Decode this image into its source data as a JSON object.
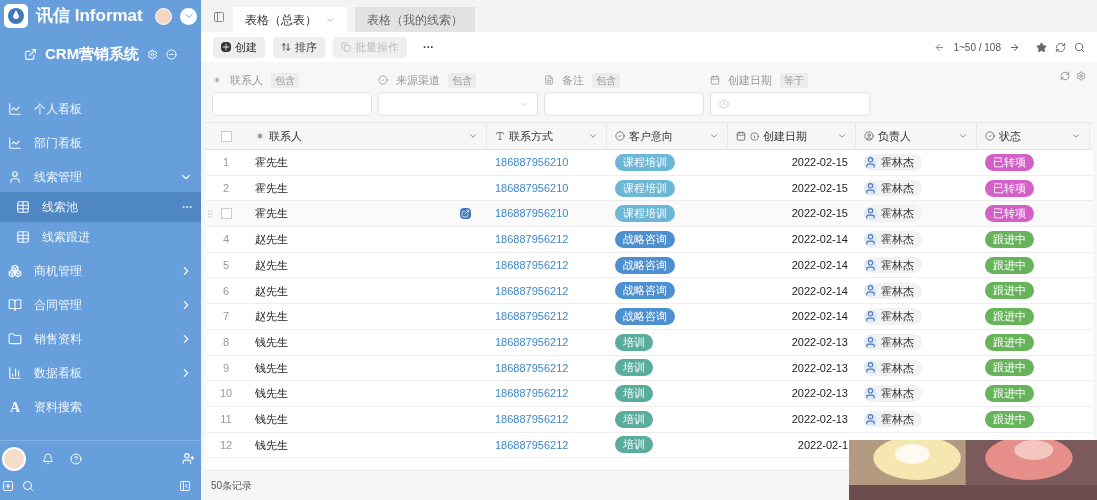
{
  "sidebar": {
    "brand": "讯信 Informat",
    "app_title": "CRM营销系统",
    "items": [
      {
        "label": "个人看板",
        "selected": false
      },
      {
        "label": "部门看板",
        "selected": false
      },
      {
        "label": "线索管理",
        "selected": false,
        "expanded": true,
        "children": [
          {
            "label": "线索池",
            "selected": true
          },
          {
            "label": "线索跟进",
            "selected": false
          }
        ]
      },
      {
        "label": "商机管理",
        "selected": false,
        "expanded": false
      },
      {
        "label": "合同管理",
        "selected": false,
        "expanded": false
      },
      {
        "label": "销售资料",
        "selected": false,
        "expanded": false
      },
      {
        "label": "数据看板",
        "selected": false,
        "expanded": false
      },
      {
        "label": "资料搜索",
        "selected": false,
        "glyph": "A"
      }
    ]
  },
  "tabs": [
    {
      "label": "表格（总表）",
      "selected": true
    },
    {
      "label": "表格（我的线索）",
      "selected": false
    }
  ],
  "toolbar": {
    "buttons": [
      {
        "label": "创建",
        "disabled": false
      },
      {
        "label": "排序",
        "disabled": false
      },
      {
        "label": "批量操作",
        "disabled": true
      }
    ],
    "more": "···",
    "pager": "1~50 / 108"
  },
  "filters": [
    {
      "label": "联系人",
      "kind": "text",
      "operator": "包含"
    },
    {
      "label": "来源渠道",
      "kind": "select",
      "operator": "包含"
    },
    {
      "label": "备注",
      "kind": "text",
      "operator": "包含"
    },
    {
      "label": "创建日期",
      "kind": "date",
      "operator": "等于"
    }
  ],
  "table": {
    "select_all": {
      "checked": false
    },
    "columns": [
      "联系人",
      "联系方式",
      "客户意向",
      "创建日期",
      "负责人",
      "状态"
    ],
    "rows": [
      {
        "index": "1",
        "hovered": false,
        "name": "霍先生",
        "phone": "186887956210",
        "intent": {
          "label": "课程培训",
          "color": "#6cb6d6"
        },
        "date": "2022-02-15",
        "owner": "霍林杰",
        "status": {
          "label": "已转项",
          "color": "#d260c6"
        }
      },
      {
        "index": "2",
        "hovered": false,
        "name": "霍先生",
        "phone": "186887956210",
        "intent": {
          "label": "课程培训",
          "color": "#6cb6d6"
        },
        "date": "2022-02-15",
        "owner": "霍林杰",
        "status": {
          "label": "已转项",
          "color": "#d260c6"
        }
      },
      {
        "hovered": true,
        "checked": false,
        "name": "霍先生",
        "phone": "186887956210",
        "intent": {
          "label": "课程培训",
          "color": "#6cb6d6"
        },
        "date": "2022-02-15",
        "owner": "霍林杰",
        "status": {
          "label": "已转项",
          "color": "#d260c6"
        }
      },
      {
        "index": "4",
        "hovered": false,
        "name": "赵先生",
        "phone": "186887956212",
        "intent": {
          "label": "战略咨询",
          "color": "#4e8fcf"
        },
        "date": "2022-02-14",
        "owner": "霍林杰",
        "status": {
          "label": "跟进中",
          "color": "#66b35a"
        }
      },
      {
        "index": "5",
        "hovered": false,
        "name": "赵先生",
        "phone": "186887956212",
        "intent": {
          "label": "战略咨询",
          "color": "#4e8fcf"
        },
        "date": "2022-02-14",
        "owner": "霍林杰",
        "status": {
          "label": "跟进中",
          "color": "#66b35a"
        }
      },
      {
        "index": "6",
        "hovered": false,
        "name": "赵先生",
        "phone": "186887956212",
        "intent": {
          "label": "战略咨询",
          "color": "#4e8fcf"
        },
        "date": "2022-02-14",
        "owner": "霍林杰",
        "status": {
          "label": "跟进中",
          "color": "#66b35a"
        }
      },
      {
        "index": "7",
        "hovered": false,
        "name": "赵先生",
        "phone": "186887956212",
        "intent": {
          "label": "战略咨询",
          "color": "#4e8fcf"
        },
        "date": "2022-02-14",
        "owner": "霍林杰",
        "status": {
          "label": "跟进中",
          "color": "#66b35a"
        }
      },
      {
        "index": "8",
        "hovered": false,
        "name": "钱先生",
        "phone": "186887956212",
        "intent": {
          "label": "培训",
          "color": "#5aad9d"
        },
        "date": "2022-02-13",
        "owner": "霍林杰",
        "status": {
          "label": "跟进中",
          "color": "#66b35a"
        }
      },
      {
        "index": "9",
        "hovered": false,
        "name": "钱先生",
        "phone": "186887956212",
        "intent": {
          "label": "培训",
          "color": "#5aad9d"
        },
        "date": "2022-02-13",
        "owner": "霍林杰",
        "status": {
          "label": "跟进中",
          "color": "#66b35a"
        }
      },
      {
        "index": "10",
        "hovered": false,
        "name": "钱先生",
        "phone": "186887956212",
        "intent": {
          "label": "培训",
          "color": "#5aad9d"
        },
        "date": "2022-02-13",
        "owner": "霍林杰",
        "status": {
          "label": "跟进中",
          "color": "#66b35a"
        }
      },
      {
        "index": "11",
        "hovered": false,
        "name": "钱先生",
        "phone": "186887956212",
        "intent": {
          "label": "培训",
          "color": "#5aad9d"
        },
        "date": "2022-02-13",
        "owner": "霍林杰",
        "status": {
          "label": "跟进中",
          "color": "#66b35a"
        }
      },
      {
        "index": "12",
        "hovered": false,
        "name": "钱先生",
        "phone": "186887956212",
        "intent": {
          "label": "培训",
          "color": "#5aad9d"
        },
        "date": "2022-02-1"
      }
    ],
    "footer": "50条记录"
  }
}
